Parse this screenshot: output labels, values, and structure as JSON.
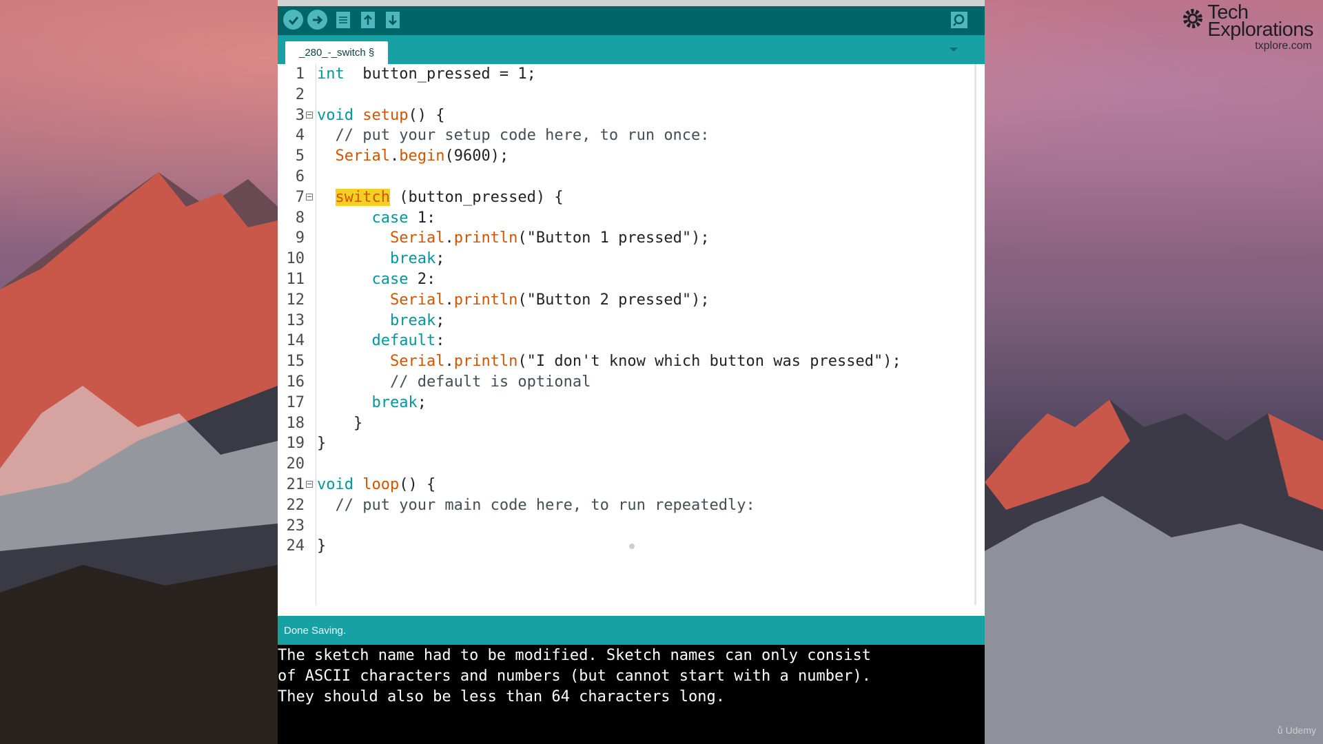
{
  "logo": {
    "line1": "Tech",
    "line2": "Explorations",
    "url": "txplore.com"
  },
  "toolbar": {
    "buttons": [
      {
        "name": "verify-button",
        "icon": "checkmark-icon"
      },
      {
        "name": "upload-button",
        "icon": "arrow-right-icon"
      },
      {
        "name": "new-button",
        "icon": "document-icon"
      },
      {
        "name": "open-button",
        "icon": "arrow-up-icon"
      },
      {
        "name": "save-button",
        "icon": "arrow-down-icon"
      },
      {
        "name": "serial-monitor-button",
        "icon": "magnifier-icon"
      }
    ]
  },
  "tab": {
    "label": "_280_-_switch §"
  },
  "editor": {
    "lines": [
      {
        "n": "1",
        "fold": false
      },
      {
        "n": "2",
        "fold": false
      },
      {
        "n": "3",
        "fold": true
      },
      {
        "n": "4",
        "fold": false
      },
      {
        "n": "5",
        "fold": false
      },
      {
        "n": "6",
        "fold": false
      },
      {
        "n": "7",
        "fold": true
      },
      {
        "n": "8",
        "fold": false
      },
      {
        "n": "9",
        "fold": false
      },
      {
        "n": "10",
        "fold": false
      },
      {
        "n": "11",
        "fold": false
      },
      {
        "n": "12",
        "fold": false
      },
      {
        "n": "13",
        "fold": false
      },
      {
        "n": "14",
        "fold": false
      },
      {
        "n": "15",
        "fold": false
      },
      {
        "n": "16",
        "fold": false
      },
      {
        "n": "17",
        "fold": false
      },
      {
        "n": "18",
        "fold": false
      },
      {
        "n": "19",
        "fold": false
      },
      {
        "n": "20",
        "fold": false
      },
      {
        "n": "21",
        "fold": true
      },
      {
        "n": "22",
        "fold": false
      },
      {
        "n": "23",
        "fold": false
      },
      {
        "n": "24",
        "fold": false
      }
    ],
    "code": [
      [
        [
          "kw",
          "int"
        ],
        [
          "",
          "  button_pressed = 1;"
        ]
      ],
      [],
      [
        [
          "kw",
          "void"
        ],
        [
          "",
          " "
        ],
        [
          "fn",
          "setup"
        ],
        [
          "",
          "() {"
        ]
      ],
      [
        [
          "cm",
          "  // put your setup code here, to run once:"
        ]
      ],
      [
        [
          "",
          "  "
        ],
        [
          "fn",
          "Serial"
        ],
        [
          "",
          "."
        ],
        [
          "fn",
          "begin"
        ],
        [
          "",
          "(9600);"
        ]
      ],
      [],
      [
        [
          "",
          "  "
        ],
        [
          "kwhl",
          "switch"
        ],
        [
          "",
          " (button_pressed) {"
        ]
      ],
      [
        [
          "",
          "      "
        ],
        [
          "kw",
          "case"
        ],
        [
          "",
          " 1:"
        ]
      ],
      [
        [
          "",
          "        "
        ],
        [
          "fn",
          "Serial"
        ],
        [
          "",
          "."
        ],
        [
          "fn",
          "println"
        ],
        [
          "",
          "(\"Button 1 pressed\");"
        ]
      ],
      [
        [
          "",
          "        "
        ],
        [
          "kw",
          "break"
        ],
        [
          "",
          ";"
        ]
      ],
      [
        [
          "",
          "      "
        ],
        [
          "kw",
          "case"
        ],
        [
          "",
          " 2:"
        ]
      ],
      [
        [
          "",
          "        "
        ],
        [
          "fn",
          "Serial"
        ],
        [
          "",
          "."
        ],
        [
          "fn",
          "println"
        ],
        [
          "",
          "(\"Button 2 pressed\");"
        ]
      ],
      [
        [
          "",
          "        "
        ],
        [
          "kw",
          "break"
        ],
        [
          "",
          ";"
        ]
      ],
      [
        [
          "",
          "      "
        ],
        [
          "kw",
          "default"
        ],
        [
          "",
          ":"
        ]
      ],
      [
        [
          "",
          "        "
        ],
        [
          "fn",
          "Serial"
        ],
        [
          "",
          "."
        ],
        [
          "fn",
          "println"
        ],
        [
          "",
          "(\"I don't know which button was pressed\");"
        ]
      ],
      [
        [
          "cm",
          "        // default is optional"
        ]
      ],
      [
        [
          "",
          "      "
        ],
        [
          "kw",
          "break"
        ],
        [
          "",
          ";"
        ]
      ],
      [
        [
          "",
          "    }"
        ]
      ],
      [
        [
          "",
          "}"
        ]
      ],
      [],
      [
        [
          "kw",
          "void"
        ],
        [
          "",
          " "
        ],
        [
          "fn",
          "loop"
        ],
        [
          "",
          "() {"
        ]
      ],
      [
        [
          "cm",
          "  // put your main code here, to run repeatedly:"
        ]
      ],
      [],
      [
        [
          "",
          "}"
        ]
      ]
    ]
  },
  "status": {
    "message": "Done Saving."
  },
  "console": {
    "lines": [
      "The sketch name had to be modified. Sketch names can only consist",
      "of ASCII characters and numbers (but cannot start with a number).",
      "They should also be less than 64 characters long."
    ]
  },
  "watermark": {
    "text": "Udemy"
  },
  "colors": {
    "toolbar": "#006468",
    "tabbar": "#17a1a5",
    "keyword": "#00979c",
    "function": "#d35400",
    "highlight": "#f5d022"
  }
}
